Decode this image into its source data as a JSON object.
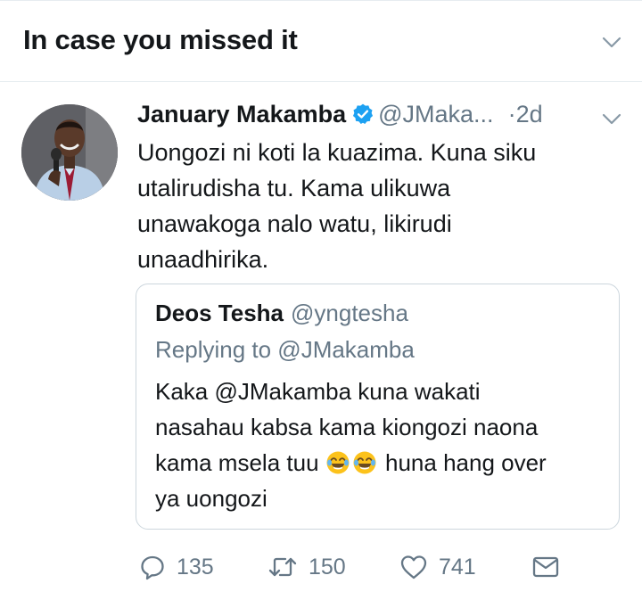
{
  "section": {
    "title": "In case you missed it"
  },
  "tweet": {
    "author_name": "January Makamba",
    "handle": "@JMaka...",
    "dot": "·",
    "time": "2d",
    "text_lines": [
      "Uongozi ni koti la kuazima. Kuna siku",
      "utalirudisha tu. Kama ulikuwa",
      "unawakoga nalo watu, likirudi",
      "unaadhirika."
    ],
    "verified_icon": "verified-badge-icon",
    "accent": "#1da1f2"
  },
  "quote": {
    "author_name": "Deos Tesha",
    "handle": "@yngtesha",
    "replying": "Replying to @JMakamba",
    "line1": "Kaka @JMakamba kuna wakati",
    "line2": "nasahau kabsa kama kiongozi naona",
    "line3_before": "kama msela tuu",
    "line3_after": "huna hang over",
    "line4": "ya uongozi",
    "emoji": "face-with-tears-of-joy-icon"
  },
  "actions": {
    "reply_count": "135",
    "retweet_count": "150",
    "like_count": "741",
    "icons": [
      "reply-icon",
      "retweet-icon",
      "like-icon",
      "direct-message-icon"
    ]
  }
}
